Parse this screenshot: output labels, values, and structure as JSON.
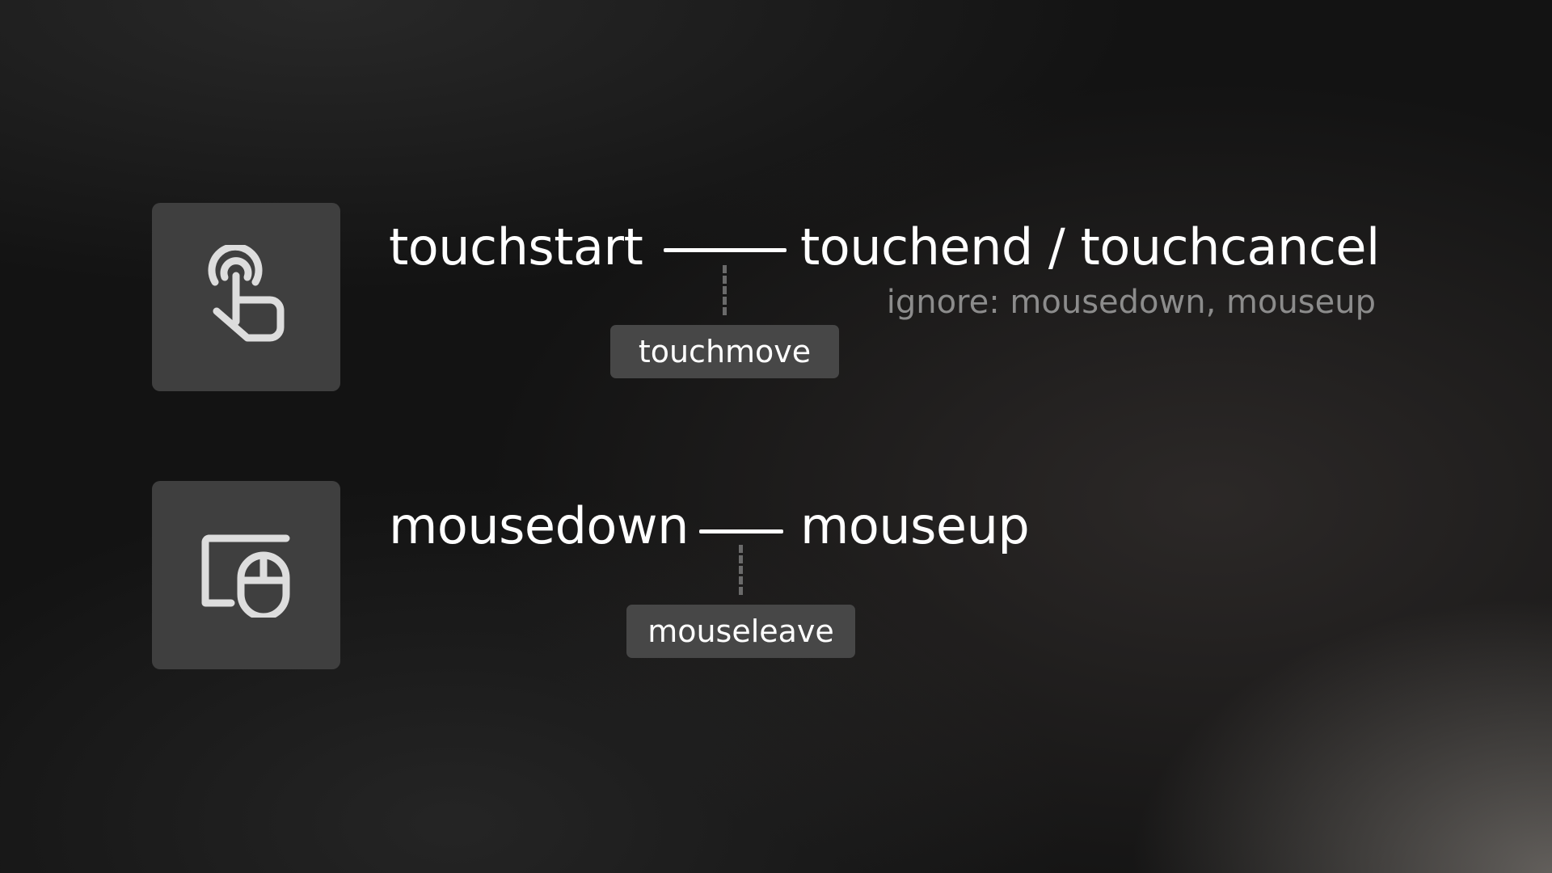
{
  "touch_row": {
    "icon": "touch-icon",
    "start_event": "touchstart",
    "end_event": "touchend / touchcancel",
    "ignore_note": "ignore: mousedown, mouseup",
    "intermediate_event": "touchmove"
  },
  "mouse_row": {
    "icon": "mouse-icon",
    "start_event": "mousedown",
    "end_event": "mouseup",
    "intermediate_event": "mouseleave"
  },
  "colors": {
    "tile": "#3f3f3f",
    "chip": "#474747",
    "text": "#ffffff",
    "muted_text": "#8c8c8c"
  }
}
